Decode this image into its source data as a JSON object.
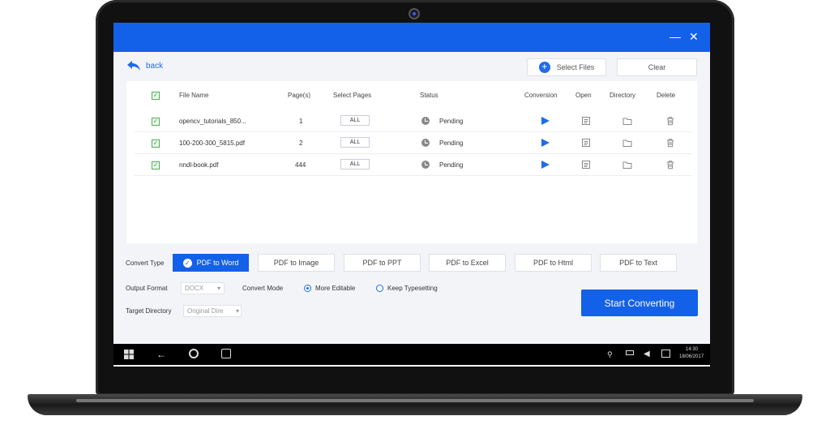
{
  "window": {
    "minimize": "—",
    "close": "✕"
  },
  "nav": {
    "back_label": "back"
  },
  "toolbar": {
    "select_files": "Select Files",
    "clear": "Clear"
  },
  "table": {
    "headers": [
      "File Name",
      "Page(s)",
      "Select Pages",
      "Status",
      "Conversion",
      "Open",
      "Directory",
      "Delete"
    ],
    "header_check": "✓",
    "rows": [
      {
        "check": "✓",
        "name": "opencv_tutorials_850...",
        "pages": "1",
        "select": "ALL",
        "status": "Pending"
      },
      {
        "check": "✓",
        "name": "100-200-300_5815.pdf",
        "pages": "2",
        "select": "ALL",
        "status": "Pending"
      },
      {
        "check": "✓",
        "name": "nndl-book.pdf",
        "pages": "444",
        "select": "ALL",
        "status": "Pending"
      }
    ]
  },
  "convert_type": {
    "label": "Convert Type",
    "check": "✓",
    "options": [
      "PDF to Word",
      "PDF to Image",
      "PDF to PPT",
      "PDF to Excel",
      "PDF to Html",
      "PDF to Text"
    ],
    "selected": "PDF to Word"
  },
  "output_format": {
    "label": "Output Format",
    "value": "DOCX",
    "arrow": "▾"
  },
  "convert_mode": {
    "label": "Convert Mode",
    "options": [
      "More Editable",
      "Keep Typesetting"
    ],
    "selected": "More Editable"
  },
  "target_directory": {
    "label": "Target Directory",
    "value": "Original Dire",
    "arrow": "▾"
  },
  "start_button": "Start Converting",
  "taskbar": {
    "time": "14:30",
    "date": "18/06/2017"
  },
  "colors": {
    "accent": "#1361e8",
    "check_green": "#4caf50"
  }
}
